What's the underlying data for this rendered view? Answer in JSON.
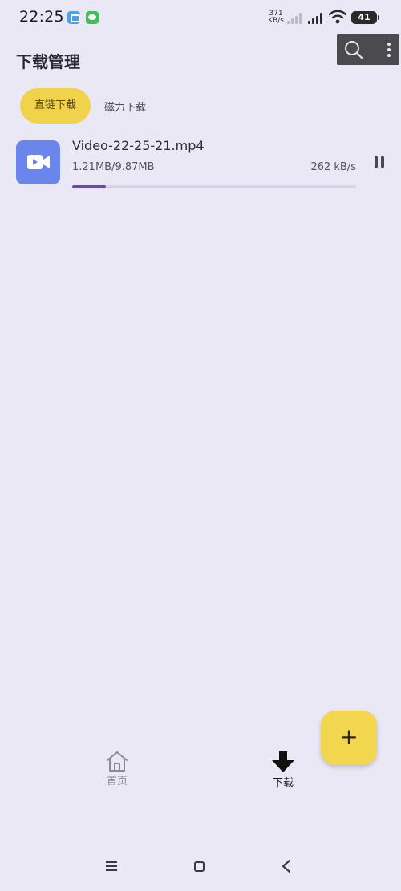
{
  "status_bar": {
    "time": "22:25",
    "net_speed_value": "371",
    "net_speed_unit": "KB/s",
    "battery": "41"
  },
  "header": {
    "title": "下载管理",
    "search_icon": "search-icon",
    "more_icon": "more-vert-icon"
  },
  "tabs": [
    {
      "label": "直链下载",
      "active": true
    },
    {
      "label": "磁力下载",
      "active": false
    }
  ],
  "downloads": [
    {
      "icon": "video-camera-icon",
      "name": "Video-22-25-21.mp4",
      "progress_text": "1.21MB/9.87MB",
      "speed": "262 kB/s",
      "progress": 0.12,
      "action_icon": "pause-icon"
    }
  ],
  "fab": {
    "label": "+",
    "icon": "plus-icon"
  },
  "bottom_nav": [
    {
      "label": "首页",
      "icon": "home-icon",
      "active": false
    },
    {
      "label": "下载",
      "icon": "download-arrow-icon",
      "active": true
    }
  ],
  "colors": {
    "background": "#ebe8f6",
    "accent_yellow": "#f0d34a",
    "file_icon_blue": "#6a86ec",
    "progress_purple": "#6a4da3"
  }
}
